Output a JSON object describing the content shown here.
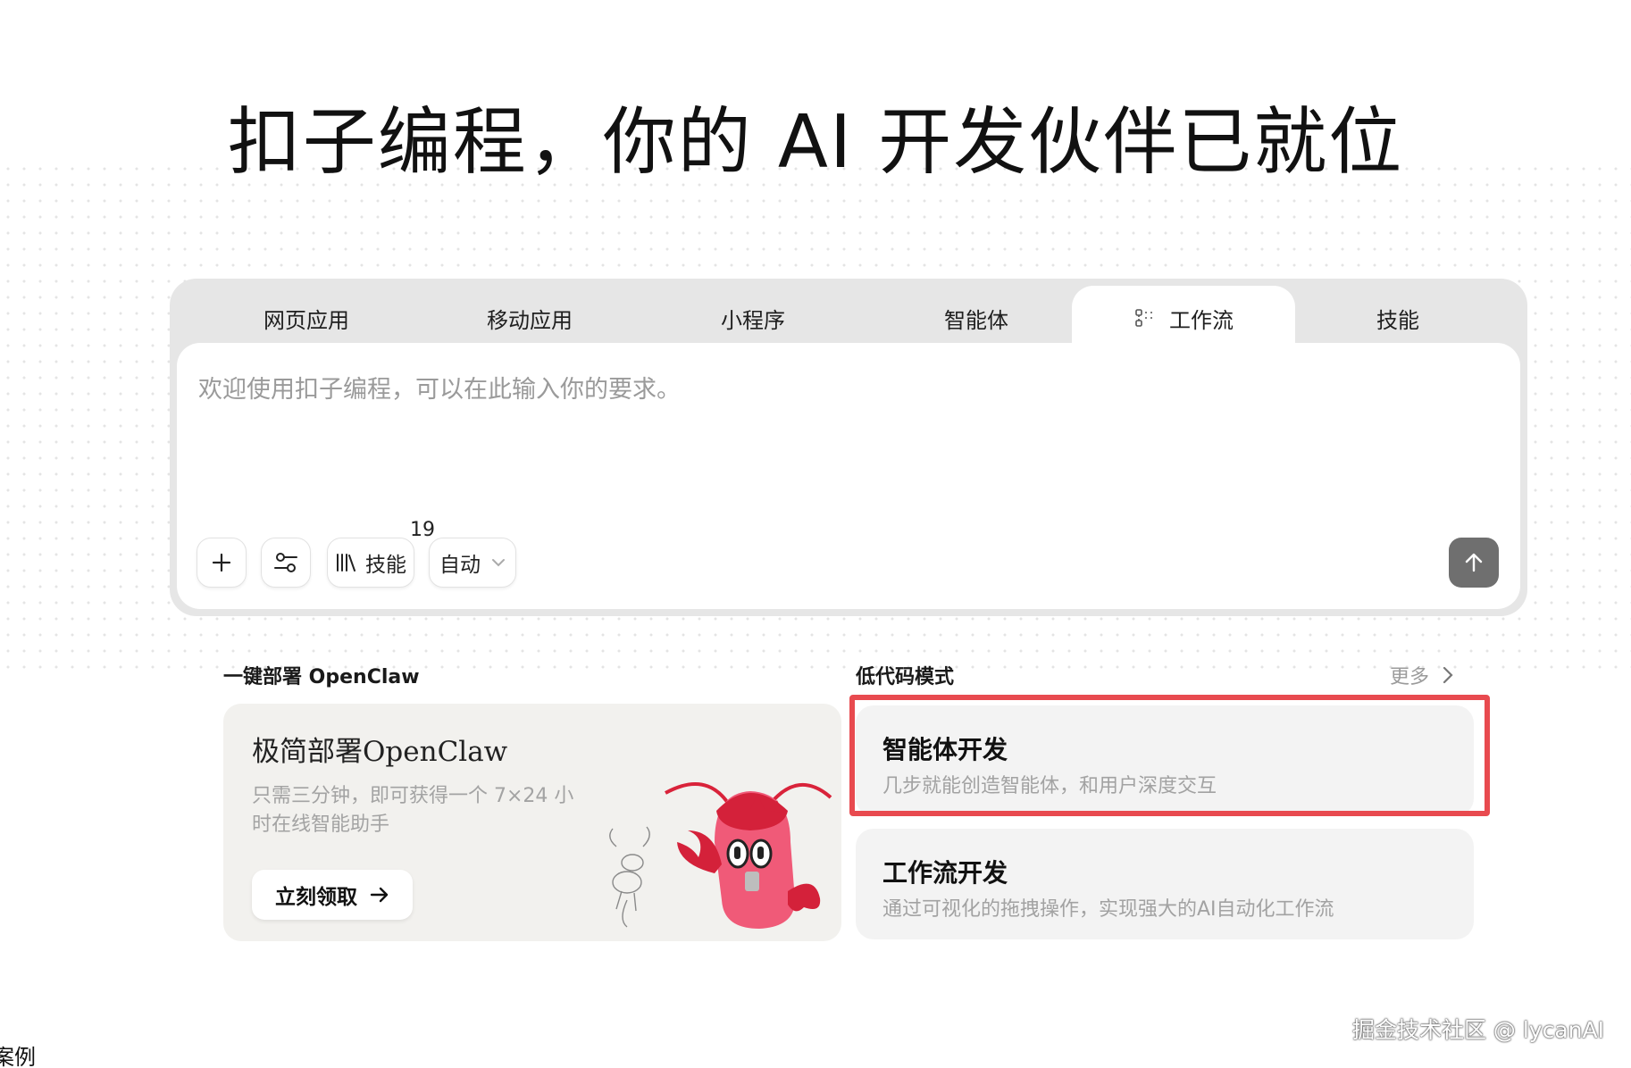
{
  "hero": {
    "title": "扣子编程，你的 AI 开发伙伴已就位"
  },
  "tabs": [
    {
      "label": "网页应用",
      "active": false
    },
    {
      "label": "移动应用",
      "active": false
    },
    {
      "label": "小程序",
      "active": false
    },
    {
      "label": "智能体",
      "active": false
    },
    {
      "label": "工作流",
      "active": true,
      "icon": "workflow-icon"
    },
    {
      "label": "技能",
      "active": false
    }
  ],
  "composer": {
    "placeholder": "欢迎使用扣子编程，可以在此输入你的要求。",
    "skills_label": "技能",
    "skills_count": "19",
    "mode_label": "自动"
  },
  "deploy": {
    "section_title": "一键部署 OpenClaw",
    "card_title": "极简部署OpenClaw",
    "card_subtitle": "只需三分钟，即可获得一个 7×24 小时在线智能助手",
    "button_label": "立刻领取"
  },
  "lowcode": {
    "section_title": "低代码模式",
    "more_label": "更多",
    "cards": [
      {
        "title": "智能体开发",
        "desc": "几步就能创造智能体，和用户深度交互",
        "highlighted": true
      },
      {
        "title": "工作流开发",
        "desc": "通过可视化的拖拽操作，实现强大的AI自动化工作流",
        "highlighted": false
      }
    ]
  },
  "footer": {
    "watermark": "掘金技术社区 @ lycanAI",
    "edge_text": "案例"
  },
  "colors": {
    "highlight": "#e84a4f",
    "send_button": "#6f6f6f",
    "panel": "#e6e6e6"
  }
}
